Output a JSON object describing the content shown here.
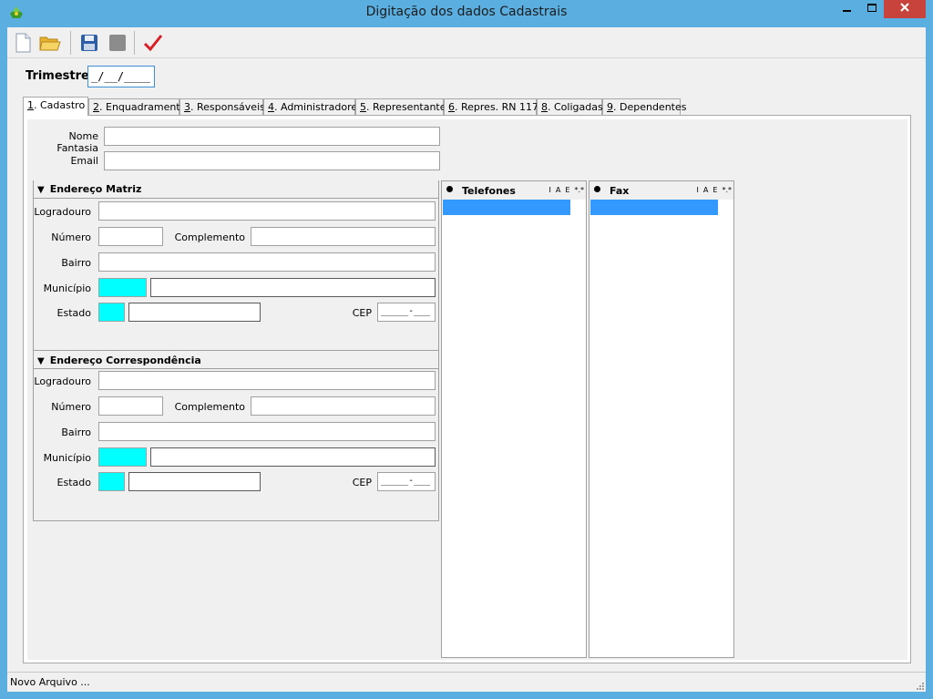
{
  "window": {
    "title": "Digitação dos dados Cadastrais"
  },
  "toolbar": {
    "buttons": [
      {
        "name": "new-file-icon"
      },
      {
        "name": "open-folder-icon"
      },
      {
        "name": "save-icon"
      },
      {
        "name": "disabled-icon"
      },
      {
        "name": "checkmark-icon"
      }
    ]
  },
  "trimestre": {
    "label": "Trimestre",
    "value": "_/__/____"
  },
  "tabs": [
    {
      "key": "1",
      "label": ". Cadastro",
      "active": true
    },
    {
      "key": "2",
      "label": ". Enquadramento"
    },
    {
      "key": "3",
      "label": ". Responsáveis"
    },
    {
      "key": "4",
      "label": ". Administradores"
    },
    {
      "key": "5",
      "label": ". Representante"
    },
    {
      "key": "6",
      "label": ". Repres. RN 117"
    },
    {
      "key": "8",
      "label": ". Coligadas"
    },
    {
      "key": "9",
      "label": ". Dependentes"
    }
  ],
  "cadastro": {
    "nome_fantasia_label": "Nome Fantasia",
    "email_label": "Email"
  },
  "endereco_matriz": {
    "title": "Endereço Matriz",
    "logradouro_label": "Logradouro",
    "numero_label": "Número",
    "complemento_label": "Complemento",
    "bairro_label": "Bairro",
    "municipio_label": "Município",
    "estado_label": "Estado",
    "cep_label": "CEP",
    "cep_value": "_____-___"
  },
  "endereco_correspondencia": {
    "title": "Endereço Correspondência",
    "logradouro_label": "Logradouro",
    "numero_label": "Número",
    "complemento_label": "Complemento",
    "bairro_label": "Bairro",
    "municipio_label": "Município",
    "estado_label": "Estado",
    "cep_label": "CEP",
    "cep_value": "_____-___"
  },
  "telefones": {
    "title": "Telefones",
    "tools": [
      "I",
      "A",
      "E",
      "*.*"
    ]
  },
  "fax": {
    "title": "Fax",
    "tools": [
      "I",
      "A",
      "E",
      "*.*"
    ]
  },
  "status": {
    "text": "Novo Arquivo ..."
  },
  "colors": {
    "title_bar": "#5aaee0",
    "close_button": "#c7433b",
    "selection": "#3399ff",
    "lookup_field": "#00ffff"
  }
}
